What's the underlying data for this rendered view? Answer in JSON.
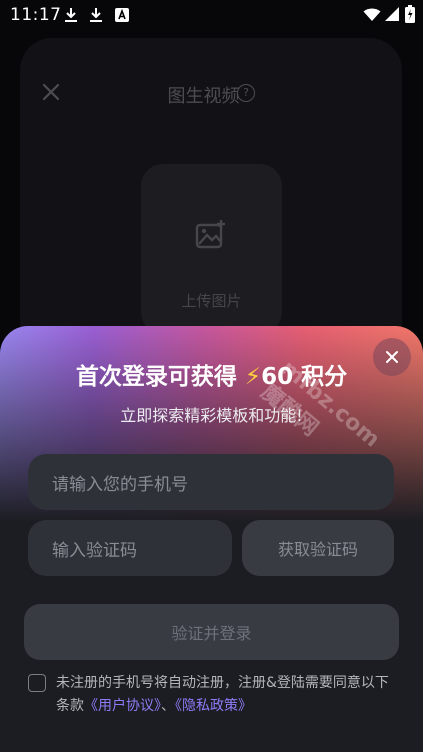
{
  "status_bar": {
    "time": "11:17",
    "icons": [
      "download-icon",
      "download-icon",
      "a-badge-icon",
      "wifi-icon",
      "signal-icon",
      "battery-icon"
    ]
  },
  "background_page": {
    "title": "图生视频",
    "help_glyph": "?",
    "upload_label": "上传图片"
  },
  "login_sheet": {
    "title_prefix": "首次登录可获得",
    "bolt": "⚡",
    "title_suffix": "60 积分",
    "subtitle": "立即探索精彩模板和功能!",
    "phone_placeholder": "请输入您的手机号",
    "code_placeholder": "输入验证码",
    "get_code_label": "获取验证码",
    "login_label": "验证并登录",
    "agreement_text": "未注册的手机号将自动注册，注册&登陆需要同意以下条款",
    "user_agreement": "《用户协议》",
    "separator": "、",
    "privacy_policy": "《隐私政策》",
    "gradient_colors": [
      "#9a87f0",
      "#c5579f",
      "#f2786a"
    ]
  },
  "watermark": "mfbz.com 魔酷网"
}
